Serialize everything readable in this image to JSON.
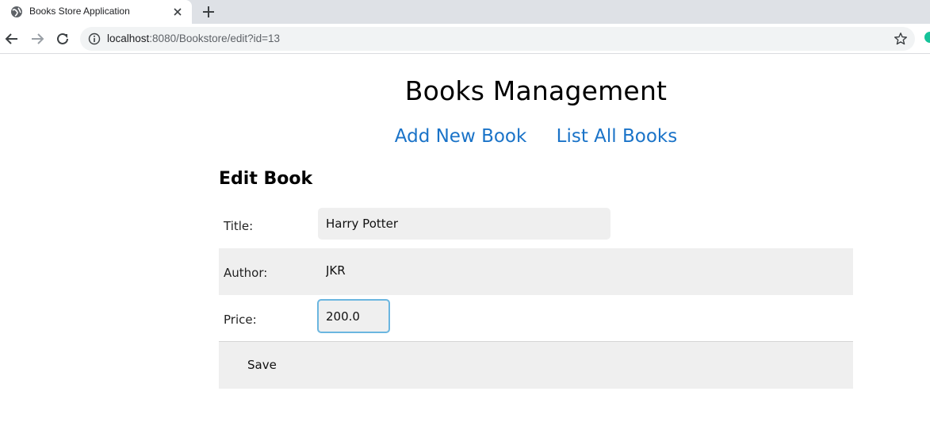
{
  "browser": {
    "tab_title": "Books Store Application",
    "url_host": "localhost",
    "url_rest": ":8080/Bookstore/edit?id=13",
    "icons": {
      "favicon": "globe-icon",
      "close": "close-icon",
      "new_tab": "plus-icon",
      "back": "back-arrow-icon",
      "forward": "forward-arrow-icon",
      "reload": "reload-icon",
      "info": "info-icon",
      "bookmark": "star-icon",
      "extension": "extension-icon"
    }
  },
  "page": {
    "title": "Books Management",
    "nav": {
      "add": "Add New Book",
      "list": "List All Books"
    },
    "form": {
      "heading": "Edit Book",
      "title_label": "Title:",
      "title_value": "Harry Potter",
      "author_label": "Author:",
      "author_value": "JKR",
      "price_label": "Price:",
      "price_value": "200.0",
      "save_label": "Save"
    }
  },
  "colors": {
    "link": "#1a73c8",
    "focus_border": "#6bb6e0",
    "row_shade": "#efefef",
    "extension": "#15c39a"
  }
}
